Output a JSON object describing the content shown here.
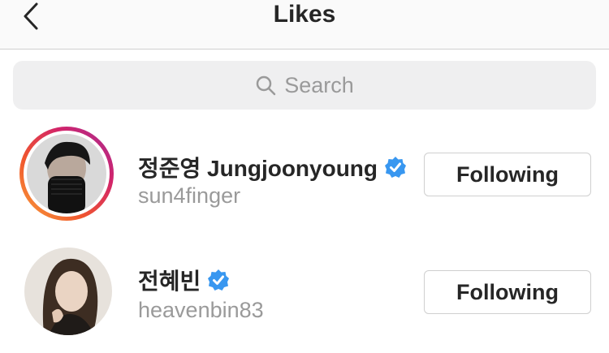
{
  "header": {
    "title": "Likes",
    "back_icon": "chevron-left-icon"
  },
  "search": {
    "placeholder": "Search",
    "icon": "search-icon"
  },
  "accent": {
    "verified": "#3897f0"
  },
  "users": [
    {
      "name": "정준영 Jungjoonyoung",
      "handle": "sun4finger",
      "verified": true,
      "story_ring": true,
      "button": "Following"
    },
    {
      "name": "전혜빈",
      "handle": "heavenbin83",
      "verified": true,
      "story_ring": false,
      "button": "Following"
    }
  ]
}
